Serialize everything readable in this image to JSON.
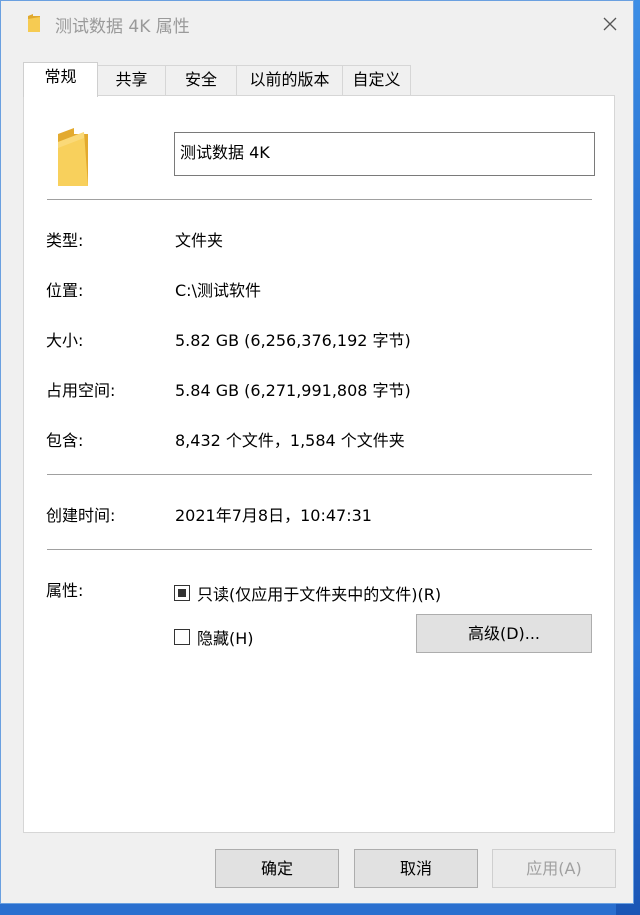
{
  "window": {
    "title": "测试数据 4K 属性"
  },
  "tabs": [
    {
      "label": "常规",
      "active": true
    },
    {
      "label": "共享"
    },
    {
      "label": "安全"
    },
    {
      "label": "以前的版本"
    },
    {
      "label": "自定义"
    }
  ],
  "general": {
    "folder_name": "测试数据 4K",
    "rows": [
      {
        "label": "类型:",
        "value": "文件夹"
      },
      {
        "label": "位置:",
        "value": "C:\\测试软件"
      },
      {
        "label": "大小:",
        "value": "5.82 GB (6,256,376,192 字节)"
      },
      {
        "label": "占用空间:",
        "value": "5.84 GB (6,271,991,808 字节)"
      },
      {
        "label": "包含:",
        "value": "8,432 个文件，1,584 个文件夹"
      }
    ],
    "created_label": "创建时间:",
    "created_value": "2021年7月8日，10:47:31",
    "attributes_label": "属性:",
    "readonly_label": "只读(仅应用于文件夹中的文件)(R)",
    "readonly_state": "indeterminate",
    "hidden_label": "隐藏(H)",
    "hidden_checked": false,
    "advanced_button": "高级(D)..."
  },
  "footer": {
    "ok": "确定",
    "cancel": "取消",
    "apply": "应用(A)"
  },
  "icons": {
    "folder": "folder-icon",
    "close": "close-icon"
  },
  "colors": {
    "folder_yellow": "#f4c74f",
    "desktop_blue": "#2a6fcf"
  }
}
